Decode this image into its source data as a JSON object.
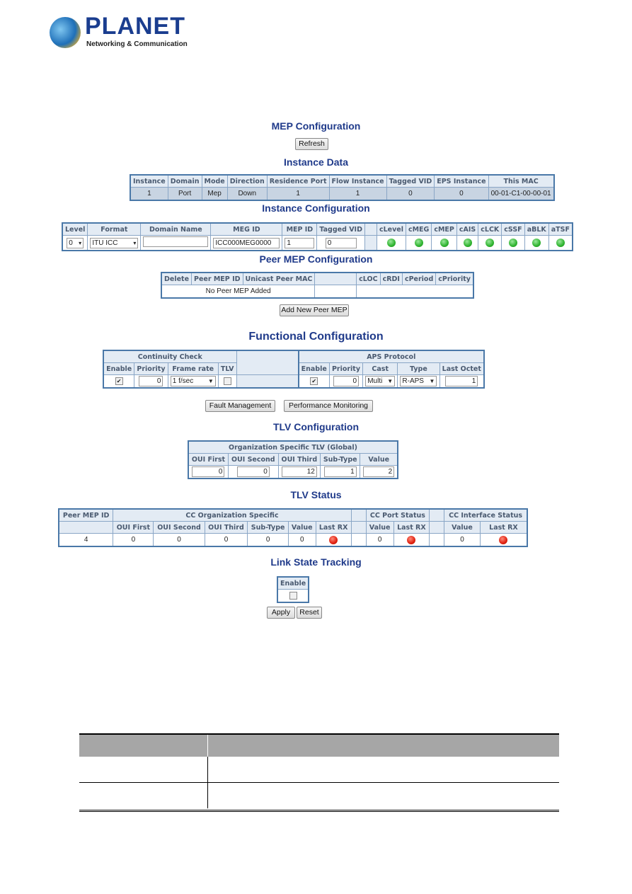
{
  "logo": {
    "brand": "PLANET",
    "tagline": "Networking & Communication"
  },
  "mep_title": "MEP Configuration",
  "refresh": "Refresh",
  "instance_data": {
    "title": "Instance Data",
    "headers": [
      "Instance",
      "Domain",
      "Mode",
      "Direction",
      "Residence Port",
      "Flow Instance",
      "Tagged VID",
      "EPS Instance",
      "This MAC"
    ],
    "row": [
      "1",
      "Port",
      "Mep",
      "Down",
      "1",
      "1",
      "0",
      "0",
      "00-01-C1-00-00-01"
    ]
  },
  "instance_config": {
    "title": "Instance Configuration",
    "headers": [
      "Level",
      "Format",
      "Domain Name",
      "MEG ID",
      "MEP ID",
      "Tagged VID",
      "",
      "cLevel",
      "cMEG",
      "cMEP",
      "cAIS",
      "cLCK",
      "cSSF",
      "aBLK",
      "aTSF"
    ],
    "level": "0",
    "format": "ITU ICC",
    "domain_name": "",
    "meg_id": "ICC000MEG0000",
    "mep_id": "1",
    "tagged_vid": "0",
    "status_colors": [
      "#2fb32f",
      "#2fb32f",
      "#2fb32f",
      "#2fb32f",
      "#2fb32f",
      "#2fb32f",
      "#2fb32f",
      "#2fb32f"
    ]
  },
  "peer": {
    "title": "Peer MEP Configuration",
    "headers": [
      "Delete",
      "Peer MEP ID",
      "Unicast Peer MAC",
      "",
      "cLOC",
      "cRDI",
      "cPeriod",
      "cPriority"
    ],
    "empty": "No Peer MEP Added",
    "add_button": "Add New Peer MEP"
  },
  "functional": {
    "title": "Functional Configuration",
    "cc_group": "Continuity Check",
    "aps_group": "APS Protocol",
    "cc_headers": [
      "Enable",
      "Priority",
      "Frame rate",
      "TLV"
    ],
    "aps_headers": [
      "Enable",
      "Priority",
      "Cast",
      "Type",
      "Last Octet"
    ],
    "cc": {
      "enable": true,
      "priority": "0",
      "frame_rate": "1 f/sec",
      "tlv": false
    },
    "aps": {
      "enable": true,
      "priority": "0",
      "cast": "Multi",
      "type": "R-APS",
      "last_octet": "1"
    },
    "fault_button": "Fault Management",
    "perf_button": "Performance Monitoring"
  },
  "tlv_config": {
    "title": "TLV Configuration",
    "group": "Organization Specific TLV (Global)",
    "headers": [
      "OUI First",
      "OUI Second",
      "OUI Third",
      "Sub-Type",
      "Value"
    ],
    "values": [
      "0",
      "0",
      "12",
      "1",
      "2"
    ]
  },
  "tlv_status": {
    "title": "TLV Status",
    "peer_header": "Peer MEP ID",
    "org_group": "CC Organization Specific",
    "port_group": "CC Port Status",
    "if_group": "CC Interface Status",
    "org_headers": [
      "OUI First",
      "OUI Second",
      "OUI Third",
      "Sub-Type",
      "Value",
      "Last RX"
    ],
    "port_headers": [
      "Value",
      "Last RX"
    ],
    "if_headers": [
      "Value",
      "Last RX"
    ],
    "row": {
      "peer": "4",
      "oui_first": "0",
      "oui_second": "0",
      "oui_third": "0",
      "sub_type": "0",
      "value": "0",
      "port_value": "0",
      "if_value": "0"
    },
    "rx_color": "#e0200f"
  },
  "link_state": {
    "title": "Link State Tracking",
    "header": "Enable",
    "enable": false
  },
  "apply": "Apply",
  "reset": "Reset"
}
